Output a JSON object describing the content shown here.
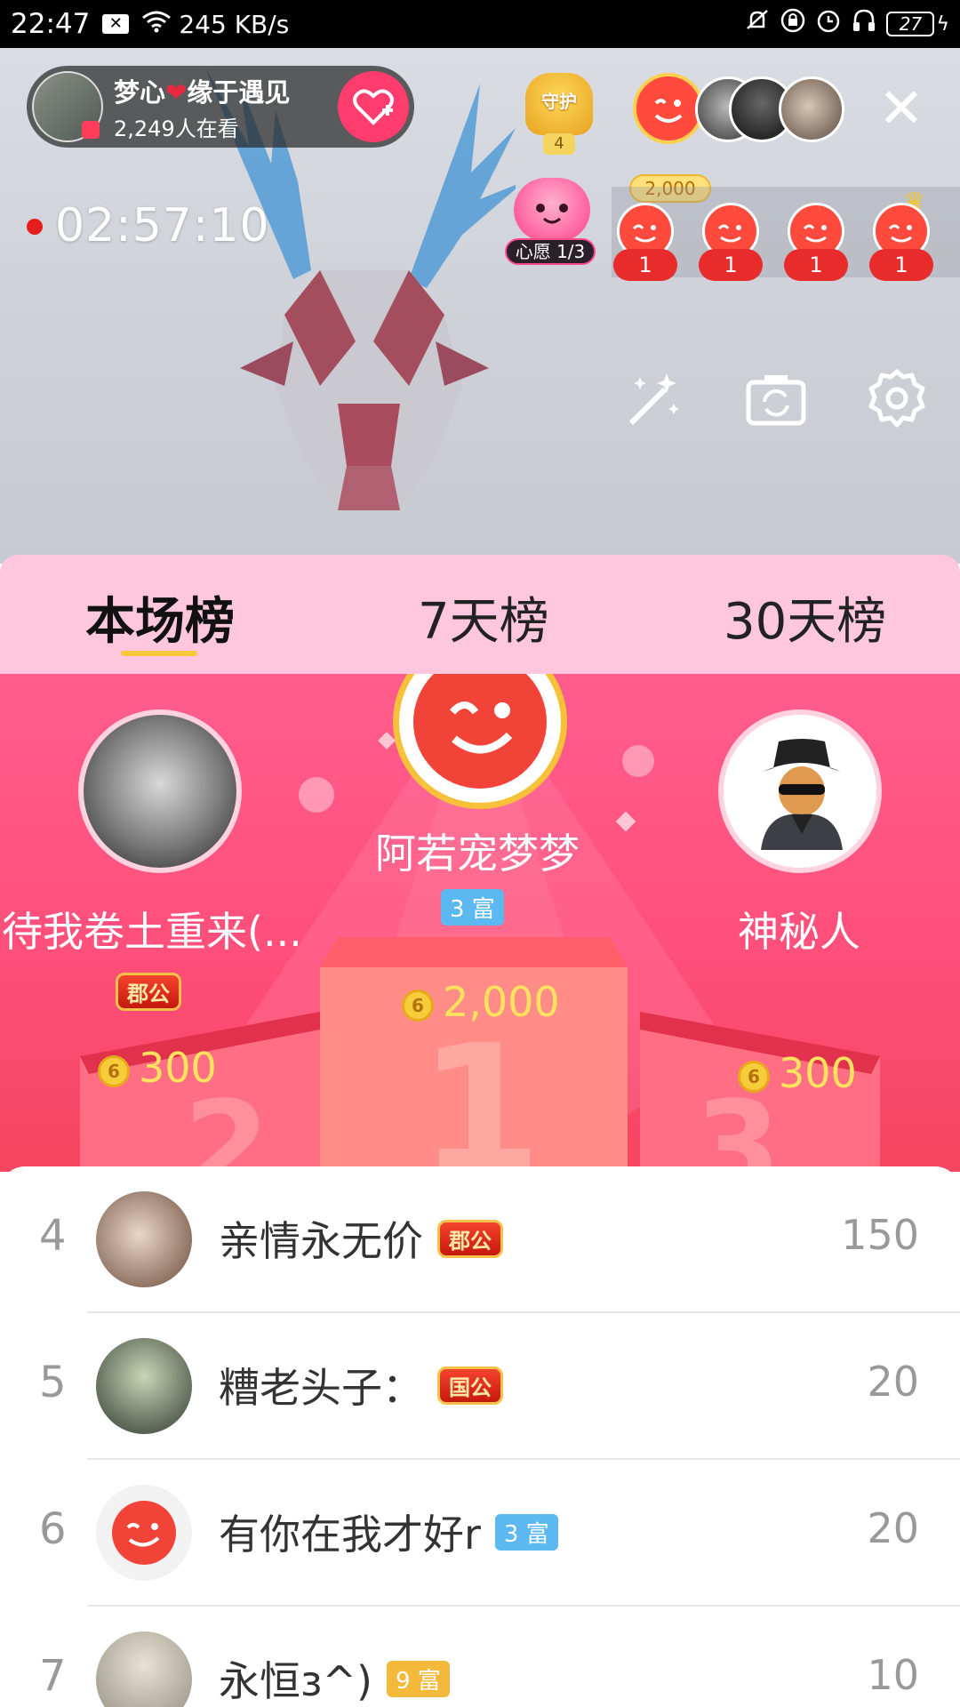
{
  "status_bar": {
    "time": "22:47",
    "network_speed": "245 KB/s",
    "battery": "27"
  },
  "stream": {
    "host_name_part1": "梦心",
    "host_name_part2": "缘于遇见",
    "viewers": "2,249人在看",
    "guard_label": "守护",
    "guard_count": "4",
    "top_fan_coins": "2,000",
    "timer": "02:57:10",
    "wish_label": "心愿 1/3",
    "wish_gifts": [
      "1",
      "1",
      "1",
      "1"
    ]
  },
  "tabs": [
    "本场榜",
    "7天榜",
    "30天榜"
  ],
  "podium": {
    "first": {
      "name": "阿若宠梦梦",
      "badge": "3 富",
      "coins": "2,000"
    },
    "second": {
      "name": "待我卷土重来(...",
      "badge": "郡公",
      "coins": "300"
    },
    "third": {
      "name": "神秘人",
      "coins": "300"
    }
  },
  "ranking": [
    {
      "rank": "4",
      "name": "亲情永无价",
      "badge": "郡公",
      "badge_type": "noble",
      "score": "150"
    },
    {
      "rank": "5",
      "name": "糟老头子：",
      "badge": "国公",
      "badge_type": "noble",
      "score": "20"
    },
    {
      "rank": "6",
      "name": "有你在我才好r",
      "badge": "3 富",
      "badge_type": "rich",
      "score": "20"
    },
    {
      "rank": "7",
      "name": "永恒з^)",
      "badge": "9 富",
      "badge_type": "rich9",
      "score": "10"
    }
  ]
}
